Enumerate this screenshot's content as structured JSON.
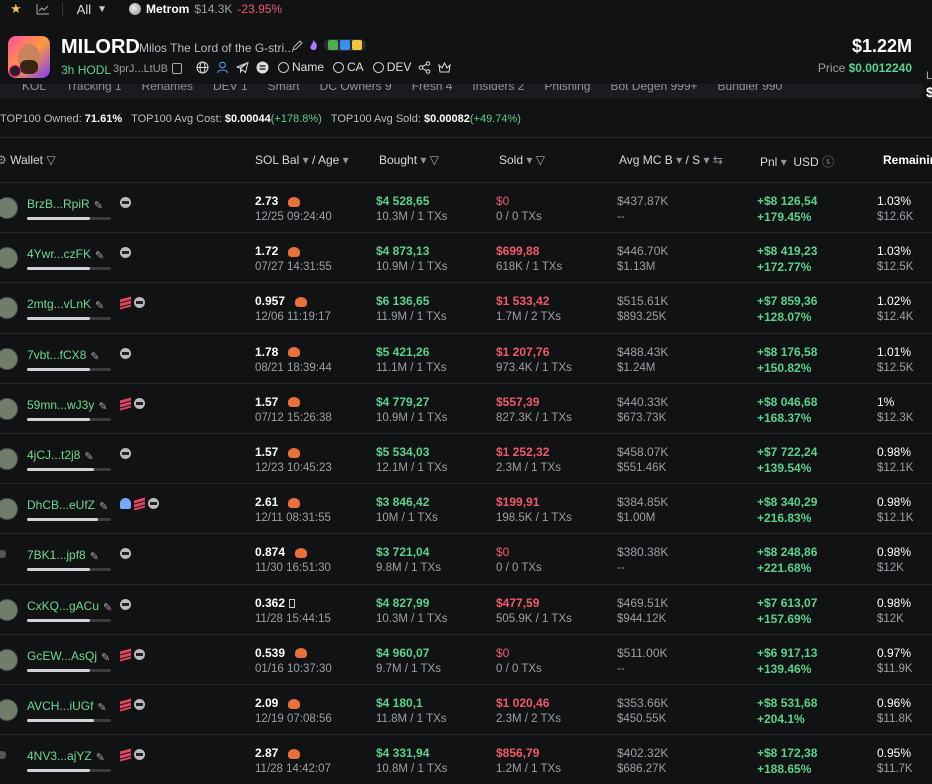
{
  "topbar": {
    "filter": "All",
    "ticker": {
      "name": "Metrom",
      "mc": "$14.3K",
      "change": "-23.95%"
    }
  },
  "token": {
    "symbol": "MILORD",
    "full_name": "Milos The Lord of the G-stri...",
    "age": "3h",
    "status": "HODL",
    "ca_short": "3prJ...LtUB",
    "search_links": [
      "Name",
      "CA",
      "DEV"
    ],
    "market_cap": "$1.22M",
    "price_label": "Price",
    "price": "$0.0012240",
    "edge_label": "L",
    "edge_value": "$"
  },
  "tabs": [
    "KOL",
    "Tracking 1",
    "Renames",
    "DEV 1",
    "Smart",
    "DC Owners 9",
    "Fresh 4",
    "Insiders 2",
    "Phishing",
    "Bot Degen 999+",
    "Bundler 990"
  ],
  "summary": {
    "owned_label": "TOP100 Owned:",
    "owned": "71.61%",
    "avg_cost_label": "TOP100 Avg Cost:",
    "avg_cost": "$0.00044",
    "avg_cost_chg": "(+178.8%)",
    "avg_sold_label": "TOP100 Avg Sold:",
    "avg_sold": "$0.00082",
    "avg_sold_chg": "(+49.74%)"
  },
  "columns": {
    "wallet": "Wallet",
    "sol_bal": "SOL Bal",
    "age": "/ Age",
    "bought": "Bought",
    "sold": "Sold",
    "avg_mc": "Avg MC B",
    "avg_mc_s": "/ S",
    "pnl": "Pnl",
    "usd": "USD",
    "remaining": "Remainin"
  },
  "rows": [
    {
      "wallet": "BrzB...RpiR",
      "tags": [
        "g"
      ],
      "bar": 0.75,
      "sol": "2.73",
      "chef": true,
      "date": "12/25 09:24:40",
      "bought": "$4 528,65",
      "bought_sub": "10.3M / 1 TXs",
      "sold": "$0",
      "sold_zero": true,
      "sold_sub": "0 / 0 TXs",
      "mcb": "$437.87K",
      "mcs": "--",
      "pnl": "+$8 126,54",
      "pnl_pct": "+179.45%",
      "rem": "1.03%",
      "rem_usd": "$12.6K"
    },
    {
      "wallet": "4Ywr...czFK",
      "tags": [
        "g"
      ],
      "bar": 0.75,
      "sol": "1.72",
      "chef": true,
      "date": "07/27 14:31:55",
      "bought": "$4 873,13",
      "bought_sub": "10.9M / 1 TXs",
      "sold": "$699,88",
      "sold_zero": false,
      "sold_sub": "618K / 1 TXs",
      "mcb": "$446.70K",
      "mcs": "$1.13M",
      "pnl": "+$8 419,23",
      "pnl_pct": "+172.77%",
      "rem": "1.03%",
      "rem_usd": "$12.5K"
    },
    {
      "wallet": "2mtg...vLnK",
      "tags": [
        "layer",
        "g"
      ],
      "bar": 0.75,
      "sol": "0.957",
      "chef": true,
      "date": "12/06 11:19:17",
      "bought": "$6 136,65",
      "bought_sub": "11.9M / 1 TXs",
      "sold": "$1 533,42",
      "sold_zero": false,
      "sold_sub": "1.7M / 2 TXs",
      "mcb": "$515.61K",
      "mcs": "$893.25K",
      "pnl": "+$7 859,36",
      "pnl_pct": "+128.07%",
      "rem": "1.02%",
      "rem_usd": "$12.4K"
    },
    {
      "wallet": "7vbt...fCX8",
      "tags": [
        "g"
      ],
      "bar": 0.75,
      "sol": "1.78",
      "chef": true,
      "date": "08/21 18:39:44",
      "bought": "$5 421,26",
      "bought_sub": "11.1M / 1 TXs",
      "sold": "$1 207,76",
      "sold_zero": false,
      "sold_sub": "973.4K / 1 TXs",
      "mcb": "$488.43K",
      "mcs": "$1.24M",
      "pnl": "+$8 176,58",
      "pnl_pct": "+150.82%",
      "rem": "1.01%",
      "rem_usd": "$12.5K"
    },
    {
      "wallet": "59mn...wJ3y",
      "tags": [
        "layer",
        "g"
      ],
      "bar": 0.75,
      "sol": "1.57",
      "chef": true,
      "date": "07/12 15:26:38",
      "bought": "$4 779,27",
      "bought_sub": "10.9M / 1 TXs",
      "sold": "$557,39",
      "sold_zero": false,
      "sold_sub": "827.3K / 1 TXs",
      "mcb": "$440.33K",
      "mcs": "$673.73K",
      "pnl": "+$8 046,68",
      "pnl_pct": "+168.37%",
      "rem": "1%",
      "rem_usd": "$12.3K"
    },
    {
      "wallet": "4jCJ...t2j8",
      "tags": [
        "g"
      ],
      "bar": 0.8,
      "sol": "1.57",
      "chef": true,
      "date": "12/23 10:45:23",
      "bought": "$5 534,03",
      "bought_sub": "12.1M / 1 TXs",
      "sold": "$1 252,32",
      "sold_zero": false,
      "sold_sub": "2.3M / 1 TXs",
      "mcb": "$458.07K",
      "mcs": "$551.46K",
      "pnl": "+$7 722,24",
      "pnl_pct": "+139.54%",
      "rem": "0.98%",
      "rem_usd": "$12.1K"
    },
    {
      "wallet": "DhCB...eUfZ",
      "tags": [
        "ghost",
        "layer",
        "g"
      ],
      "bar": 0.85,
      "sol": "2.61",
      "chef": true,
      "date": "12/11 08:31:55",
      "bought": "$3 846,42",
      "bought_sub": "10M / 1 TXs",
      "sold": "$199,91",
      "sold_zero": false,
      "sold_sub": "198.5K / 1 TXs",
      "mcb": "$384.85K",
      "mcs": "$1.00M",
      "pnl": "+$8 340,29",
      "pnl_pct": "+216.83%",
      "rem": "0.98%",
      "rem_usd": "$12.1K"
    },
    {
      "wallet": "7BK1...jpf8",
      "tags": [
        "g"
      ],
      "bar": 0.75,
      "sol": "0.874",
      "chef": true,
      "date": "11/30 16:51:30",
      "bought": "$3 721,04",
      "bought_sub": "9.8M / 1 TXs",
      "sold": "$0",
      "sold_zero": true,
      "sold_sub": "0 / 0 TXs",
      "mcb": "$380.38K",
      "mcs": "--",
      "pnl": "+$8 248,86",
      "pnl_pct": "+221.68%",
      "rem": "0.98%",
      "rem_usd": "$12K",
      "small_av": true
    },
    {
      "wallet": "CxKQ...gACu",
      "tags": [
        "g"
      ],
      "bar": 0.75,
      "sol": "0.362",
      "chef": false,
      "glyph": true,
      "date": "11/28 15:44:15",
      "bought": "$4 827,99",
      "bought_sub": "10.3M / 1 TXs",
      "sold": "$477,59",
      "sold_zero": false,
      "sold_sub": "505.9K / 1 TXs",
      "mcb": "$469.51K",
      "mcs": "$944.12K",
      "pnl": "+$7 613,07",
      "pnl_pct": "+157.69%",
      "rem": "0.98%",
      "rem_usd": "$12K"
    },
    {
      "wallet": "GcEW...AsQj",
      "tags": [
        "layer",
        "g"
      ],
      "bar": 0.75,
      "sol": "0.539",
      "chef": true,
      "date": "01/16 10:37:30",
      "bought": "$4 960,07",
      "bought_sub": "9.7M / 1 TXs",
      "sold": "$0",
      "sold_zero": true,
      "sold_sub": "0 / 0 TXs",
      "mcb": "$511.00K",
      "mcs": "--",
      "pnl": "+$6 917,13",
      "pnl_pct": "+139.46%",
      "rem": "0.97%",
      "rem_usd": "$11.9K"
    },
    {
      "wallet": "AVCH...iUGf",
      "tags": [
        "layer",
        "g"
      ],
      "bar": 0.8,
      "sol": "2.09",
      "chef": true,
      "date": "12/19 07:08:56",
      "bought": "$4 180,1",
      "bought_sub": "11.8M / 1 TXs",
      "sold": "$1 020,46",
      "sold_zero": false,
      "sold_sub": "2.3M / 2 TXs",
      "mcb": "$353.66K",
      "mcs": "$450.55K",
      "pnl": "+$8 531,68",
      "pnl_pct": "+204.1%",
      "rem": "0.96%",
      "rem_usd": "$11.8K"
    },
    {
      "wallet": "4NV3...ajYZ",
      "tags": [
        "layer",
        "g"
      ],
      "bar": 0.75,
      "sol": "2.87",
      "chef": true,
      "date": "11/28 14:42:07",
      "bought": "$4 331,94",
      "bought_sub": "10.8M / 1 TXs",
      "sold": "$856,79",
      "sold_zero": false,
      "sold_sub": "1.2M / 1 TXs",
      "mcb": "$402.32K",
      "mcs": "$686.27K",
      "pnl": "+$8 172,38",
      "pnl_pct": "+188.65%",
      "rem": "0.95%",
      "rem_usd": "$11.7K",
      "small_av": true
    }
  ]
}
